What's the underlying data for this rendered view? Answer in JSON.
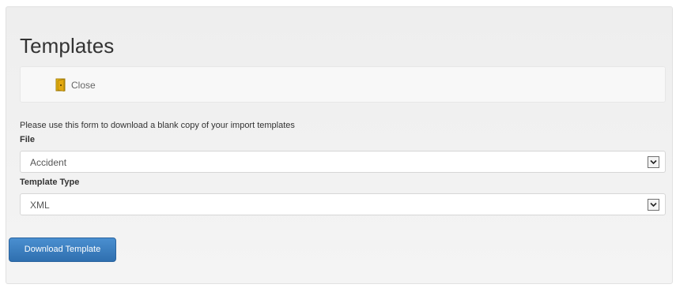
{
  "header": {
    "title": "Templates"
  },
  "toolbar": {
    "close_label": "Close",
    "close_icon": "exit-door-icon"
  },
  "form": {
    "intro": "Please use this form to download a blank copy of your import templates",
    "file": {
      "label": "File",
      "selected": "Accident"
    },
    "template_type": {
      "label": "Template Type",
      "selected": "XML"
    },
    "submit_label": "Download Template"
  },
  "colors": {
    "button_blue": "#357ebd",
    "panel_bg": "#f0f0f0",
    "icon_yellow": "#f2c31a"
  }
}
